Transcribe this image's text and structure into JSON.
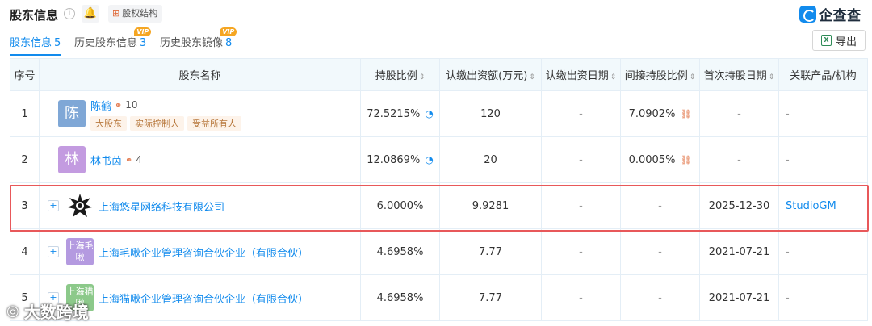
{
  "header": {
    "title": "股东信息",
    "structure_label": "股权结构",
    "logo_text": "企查查"
  },
  "tabs": [
    {
      "label": "股东信息",
      "count": "5",
      "vip": ""
    },
    {
      "label": "历史股东信息",
      "count": "3",
      "vip": "VIP"
    },
    {
      "label": "历史股东镜像",
      "count": "8",
      "vip": "VIP"
    }
  ],
  "export_label": "导出",
  "table": {
    "headers": [
      "序号",
      "股东名称",
      "持股比例",
      "认缴出资额(万元)",
      "认缴出资日期",
      "间接持股比例",
      "首次持股日期",
      "关联产品/机构"
    ],
    "rows": [
      {
        "index": "1",
        "avatar": "陈",
        "avatar_color": "#7fa7d6",
        "name": "陈鹤",
        "rel_count": "10",
        "tags": [
          "大股东",
          "实际控制人",
          "受益所有人"
        ],
        "ratio": "72.5215%",
        "capital": "120",
        "date": "-",
        "indirect": "7.0902%",
        "first_date": "-",
        "product": "-"
      },
      {
        "index": "2",
        "avatar": "林",
        "avatar_color": "#c39be0",
        "name": "林书茵",
        "rel_count": "4",
        "tags": [],
        "ratio": "12.0869%",
        "capital": "20",
        "date": "-",
        "indirect": "0.0005%",
        "first_date": "-",
        "product": "-"
      },
      {
        "index": "3",
        "avatar": "",
        "avatar_color": "#ffffff",
        "name": "上海悠星网络科技有限公司",
        "rel_count": "",
        "tags": [],
        "ratio": "6.0000%",
        "capital": "9.9281",
        "date": "-",
        "indirect": "-",
        "first_date": "2025-12-30",
        "product": "StudioGM"
      },
      {
        "index": "4",
        "avatar": "上海毛啾",
        "avatar_color": "#b49ae0",
        "name": "上海毛啾企业管理咨询合伙企业（有限合伙）",
        "rel_count": "",
        "tags": [],
        "ratio": "4.6958%",
        "capital": "7.77",
        "date": "-",
        "indirect": "-",
        "first_date": "2021-07-21",
        "product": "-"
      },
      {
        "index": "5",
        "avatar": "上海猫啾",
        "avatar_color": "#8cc98a",
        "name": "上海猫啾企业管理咨询合伙企业（有限合伙）",
        "rel_count": "",
        "tags": [],
        "ratio": "4.6958%",
        "capital": "7.77",
        "date": "-",
        "indirect": "-",
        "first_date": "2021-07-21",
        "product": "-"
      }
    ]
  },
  "watermark_text": "大数跨境",
  "colors": {
    "accent": "#128bed",
    "highlight": "#e8585a",
    "header_bg": "#f2f9fc"
  }
}
